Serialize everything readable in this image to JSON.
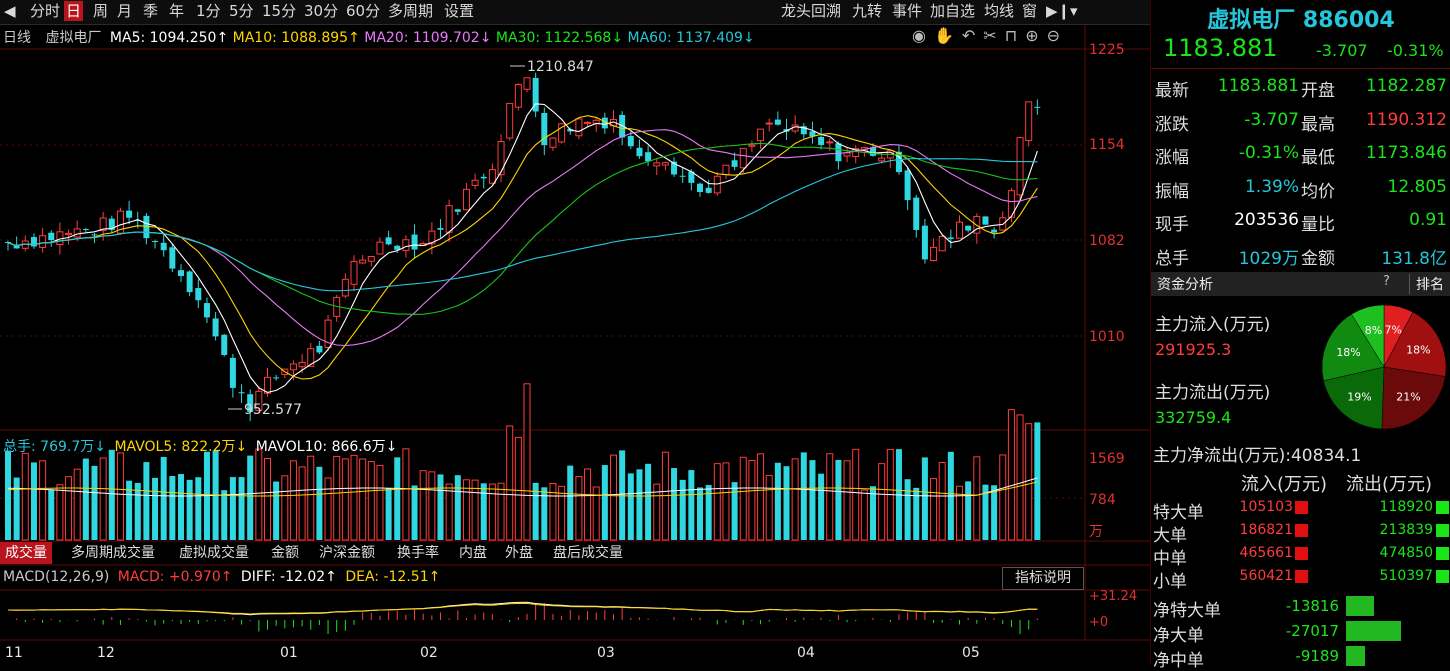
{
  "toolbar": {
    "left": [
      "分时",
      "日",
      "周",
      "月",
      "季",
      "年",
      "1分",
      "5分",
      "15分",
      "30分",
      "60分",
      "多周期",
      "设置"
    ],
    "active": "日",
    "right": [
      "龙头回溯",
      "九转",
      "事件",
      "加自选",
      "均线",
      "窗"
    ]
  },
  "ma_line": {
    "period": "日线",
    "name": "虚拟电厂",
    "ma5": "MA5: 1094.250↑",
    "ma10": "MA10: 1088.895↑",
    "ma20": "MA20: 1109.702↓",
    "ma30": "MA30: 1122.568↓",
    "ma60": "MA60: 1137.409↓"
  },
  "price_axis": [
    "1225",
    "1154",
    "1082",
    "1010"
  ],
  "annotations": {
    "high": "1210.847",
    "low": "952.577"
  },
  "volume": {
    "header_total": "总手: 769.7万↓",
    "header_mavol5": "MAVOL5: 822.2万↓",
    "header_mavol10": "MAVOL10: 866.6万↓",
    "axis": [
      "1569",
      "784",
      "万"
    ]
  },
  "sub_tabs": [
    "成交量",
    "多周期成交量",
    "虚拟成交量",
    "金额",
    "沪深金额",
    "换手率",
    "内盘",
    "外盘",
    "盘后成交量"
  ],
  "macd": {
    "label": "MACD(12,26,9)",
    "macd": "MACD: +0.970↑",
    "diff": "DIFF: -12.02↑",
    "dea": "DEA: -12.51↑",
    "button": "指标说明",
    "axis": [
      "+31.24",
      "+0"
    ]
  },
  "months": [
    "11",
    "12",
    "01",
    "02",
    "03",
    "04",
    "05"
  ],
  "header": {
    "title": "虚拟电厂 886004",
    "price": "1183.881",
    "change": "-3.707",
    "pct": "-0.31%"
  },
  "stats": [
    {
      "l1": "最新",
      "v1": "1183.881",
      "c1": "green",
      "l2": "开盘",
      "v2": "1182.287",
      "c2": "green"
    },
    {
      "l1": "涨跌",
      "v1": "-3.707",
      "c1": "green",
      "l2": "最高",
      "v2": "1190.312",
      "c2": "red"
    },
    {
      "l1": "涨幅",
      "v1": "-0.31%",
      "c1": "green",
      "l2": "最低",
      "v2": "1173.846",
      "c2": "green"
    },
    {
      "l1": "振幅",
      "v1": "1.39%",
      "c1": "cyan",
      "l2": "均价",
      "v2": "12.805",
      "c2": "green"
    },
    {
      "l1": "现手",
      "v1": "203536",
      "c1": "white",
      "l2": "量比",
      "v2": "0.91",
      "c2": "green"
    },
    {
      "l1": "总手",
      "v1": "1029万",
      "c1": "cyan",
      "l2": "金额",
      "v2": "131.8亿",
      "c2": "cyan"
    }
  ],
  "fund": {
    "tab": "资金分析",
    "q": "?",
    "rank": "排名",
    "in_label": "主力流入(万元)",
    "in_val": "291925.3",
    "out_label": "主力流出(万元)",
    "out_val": "332759.4",
    "net": "主力净流出(万元):40834.1",
    "pie": [
      {
        "label": "7%",
        "value": 7,
        "color": "#e02020"
      },
      {
        "label": "18%",
        "value": 18,
        "color": "#a01010"
      },
      {
        "label": "21%",
        "value": 21,
        "color": "#6a0a0a"
      },
      {
        "label": "19%",
        "value": 19,
        "color": "#0a6a0a"
      },
      {
        "label": "18%",
        "value": 18,
        "color": "#118a11"
      },
      {
        "label": "8%",
        "value": 8,
        "color": "#1fbf1f"
      }
    ],
    "col_in": "流入(万元)",
    "col_out": "流出(万元)",
    "orders": [
      {
        "name": "特大单",
        "in": "105103",
        "out": "118920"
      },
      {
        "name": "大单",
        "in": "186821",
        "out": "213839"
      },
      {
        "name": "中单",
        "in": "465661",
        "out": "474850"
      },
      {
        "name": "小单",
        "in": "560421",
        "out": "510397"
      }
    ],
    "net_rows": [
      {
        "name": "净特大单",
        "val": "-13816",
        "frac": 0.5
      },
      {
        "name": "净大单",
        "val": "-27017",
        "frac": 1.0
      },
      {
        "name": "净中单",
        "val": "-9189",
        "frac": 0.34
      }
    ]
  }
}
